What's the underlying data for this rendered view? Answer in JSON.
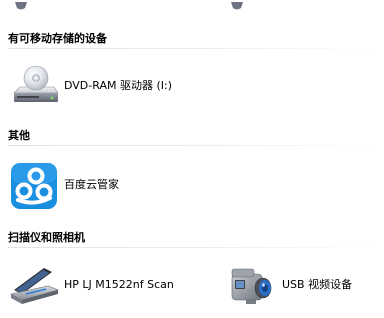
{
  "groups": [
    {
      "header": "有可移动存储的设备",
      "items": [
        {
          "label": "DVD-RAM 驱动器 (I:)",
          "icon": "dvd-drive-icon"
        }
      ]
    },
    {
      "header": "其他",
      "items": [
        {
          "label": "百度云管家",
          "icon": "baidu-cloud-icon"
        }
      ]
    },
    {
      "header": "扫描仪和照相机",
      "items": [
        {
          "label": "HP LJ M1522nf Scan",
          "icon": "scanner-icon"
        },
        {
          "label": "USB 视频设备",
          "icon": "video-camera-icon"
        }
      ]
    }
  ],
  "colors": {
    "baidu_blue": "#1a8fe0",
    "header_rule": "#dfe3ec"
  }
}
